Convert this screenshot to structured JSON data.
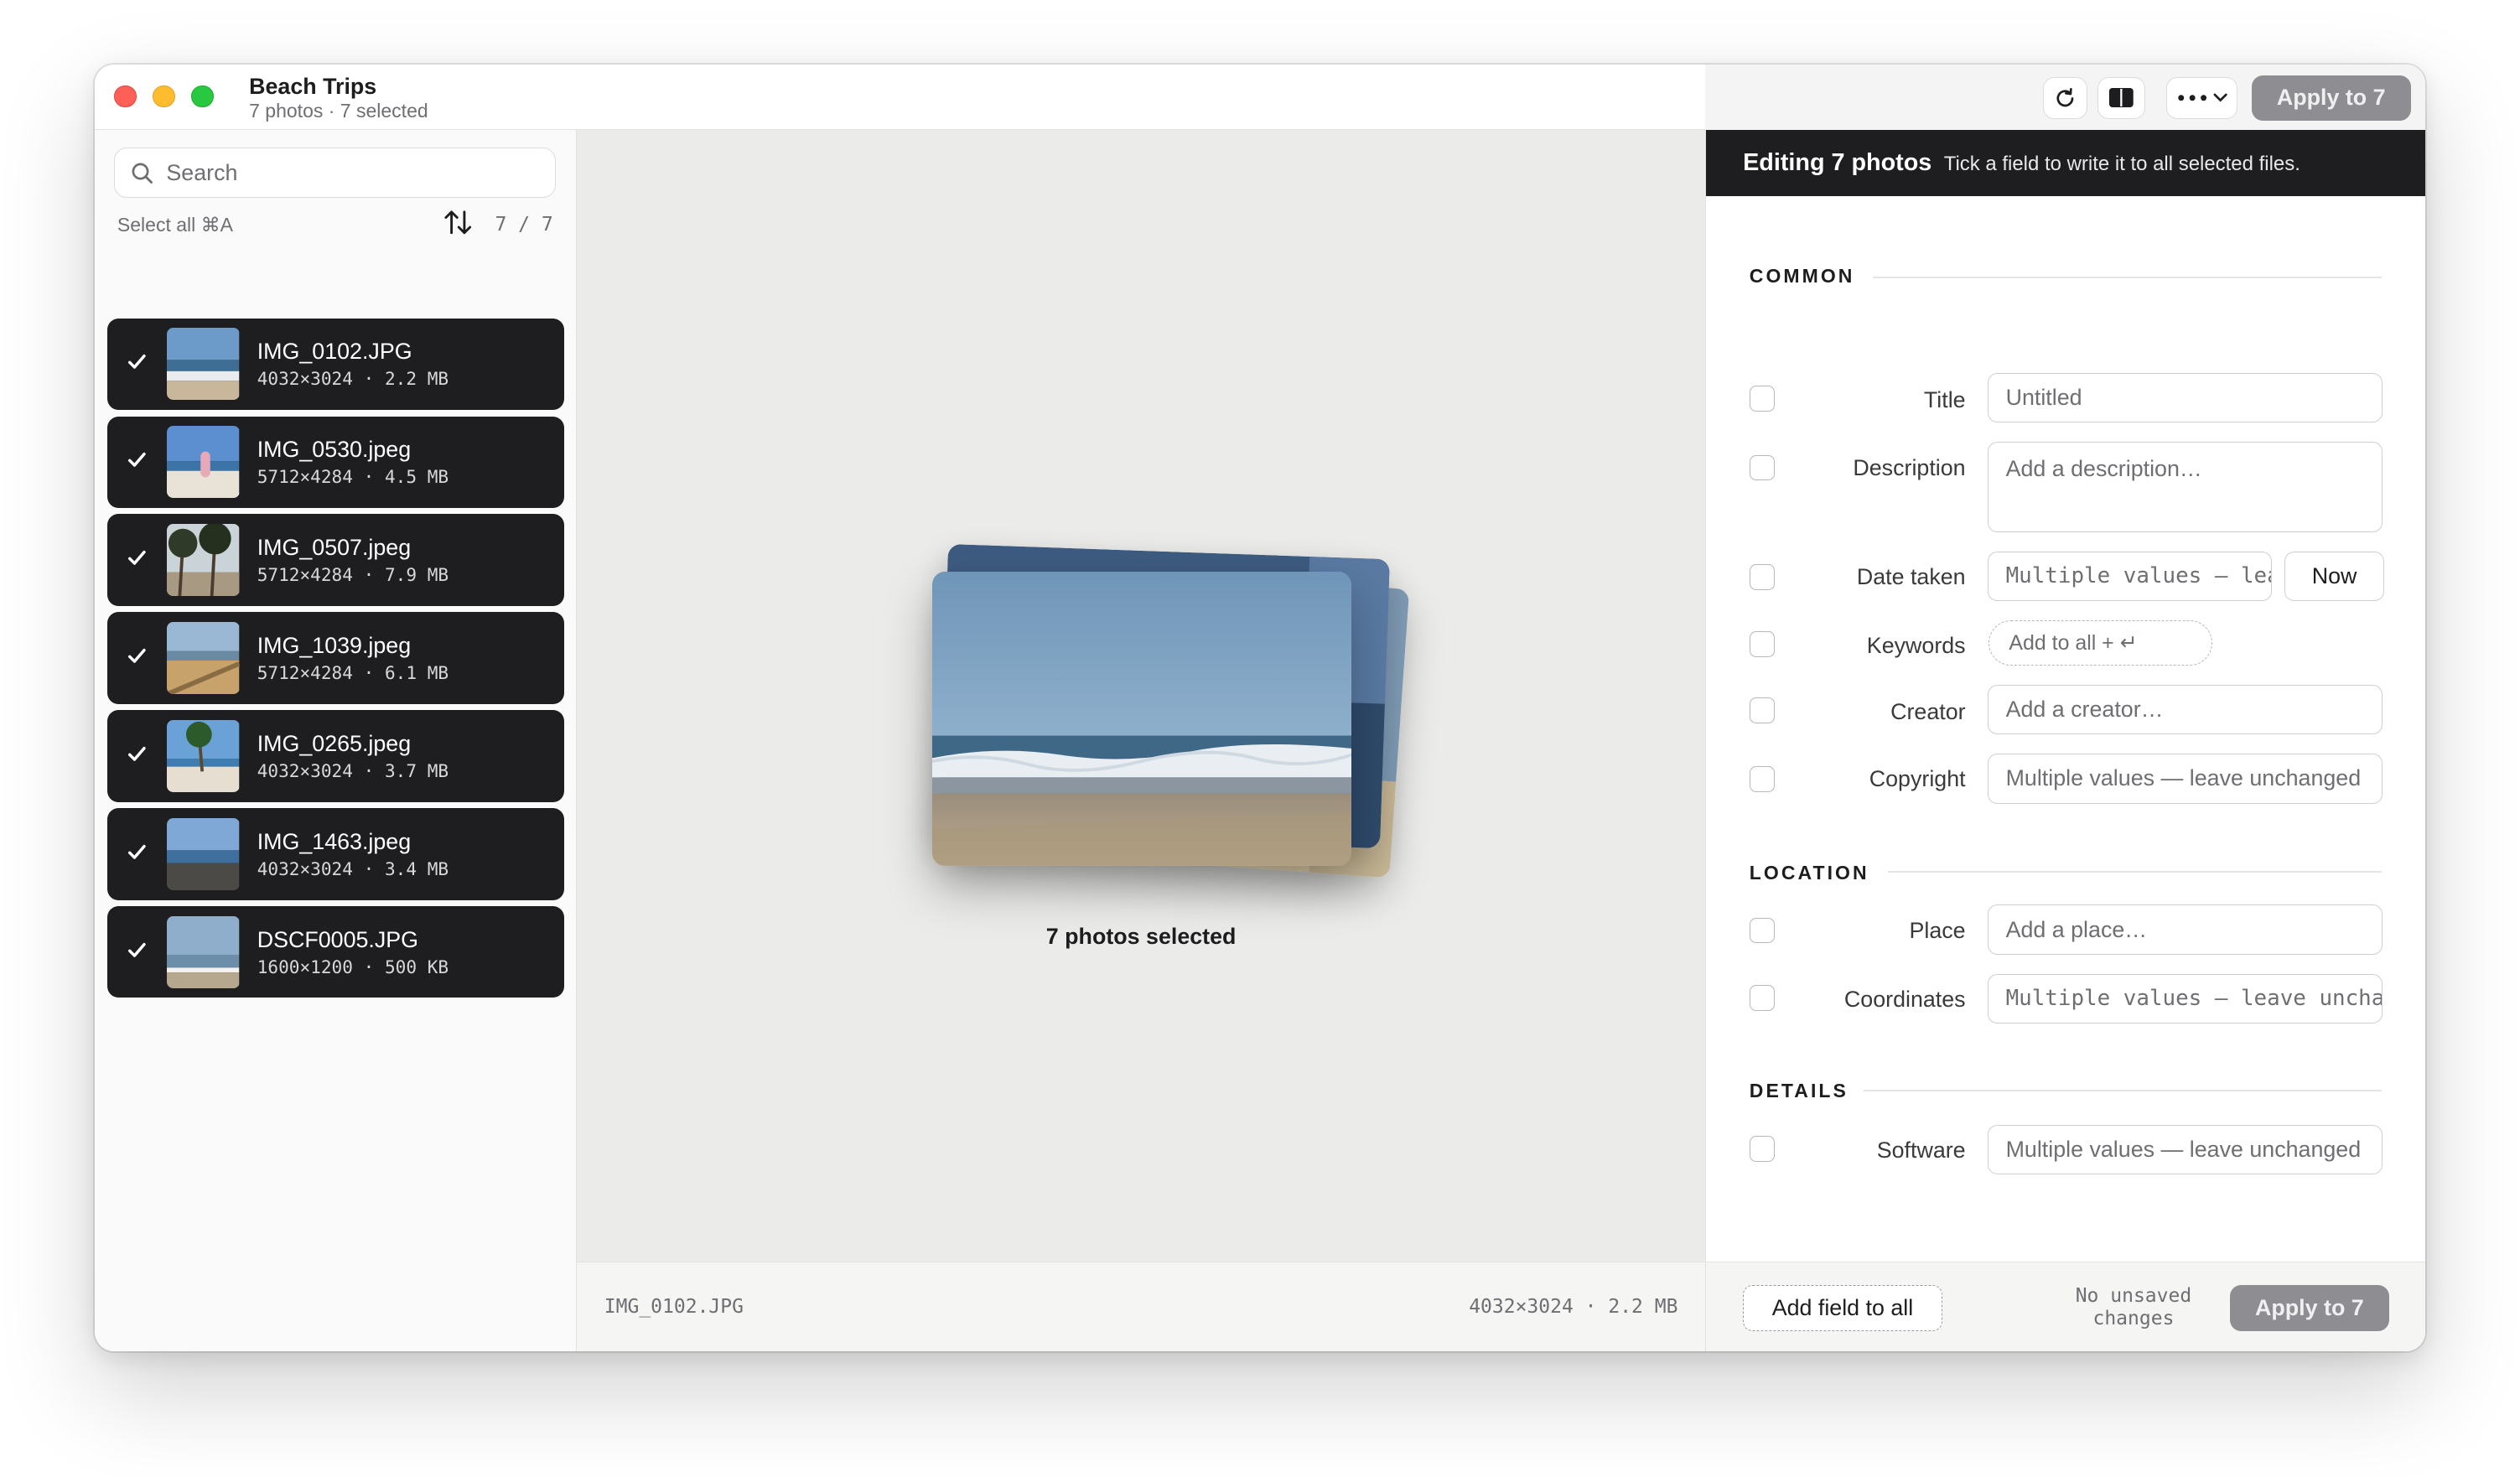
{
  "window": {
    "title": "Beach Trips",
    "subtitle": "7 photos · 7 selected"
  },
  "toolbar": {
    "refresh_icon": "refresh-icon",
    "split_icon": "split-view-icon",
    "more_icon": "more-icon",
    "apply_label": "Apply to 7"
  },
  "sidebar": {
    "search_placeholder": "Search",
    "select_all": "Select all ⌘A",
    "count": "7 / 7",
    "files": [
      {
        "name": "IMG_0102.JPG",
        "meta": "4032×3024 · 2.2 MB",
        "checked": true
      },
      {
        "name": "IMG_0530.jpeg",
        "meta": "5712×4284 · 4.5 MB",
        "checked": true
      },
      {
        "name": "IMG_0507.jpeg",
        "meta": "5712×4284 · 7.9 MB",
        "checked": true
      },
      {
        "name": "IMG_1039.jpeg",
        "meta": "5712×4284 · 6.1 MB",
        "checked": true
      },
      {
        "name": "IMG_0265.jpeg",
        "meta": "4032×3024 · 3.7 MB",
        "checked": true
      },
      {
        "name": "IMG_1463.jpeg",
        "meta": "4032×3024 · 3.4 MB",
        "checked": true
      },
      {
        "name": "DSCF0005.JPG",
        "meta": "1600×1200 · 500 KB",
        "checked": true
      }
    ]
  },
  "preview": {
    "caption": "7 photos selected",
    "status_left": "IMG_0102.JPG",
    "status_right": "4032×3024 · 2.2 MB"
  },
  "editor": {
    "banner_title": "Editing 7 photos",
    "banner_subtitle": "Tick a field to write it to all selected files.",
    "sections": {
      "common": "COMMON",
      "location": "LOCATION",
      "details": "DETAILS"
    },
    "fields": {
      "title": {
        "label": "Title",
        "placeholder": "Untitled"
      },
      "description": {
        "label": "Description",
        "placeholder": "Add a description…"
      },
      "date_taken": {
        "label": "Date taken",
        "value": "Multiple values — leave unchanged",
        "now_label": "Now"
      },
      "keywords": {
        "label": "Keywords",
        "placeholder": "Add to all + ↵"
      },
      "creator": {
        "label": "Creator",
        "placeholder": "Add a creator…"
      },
      "copyright": {
        "label": "Copyright",
        "value": "Multiple values — leave unchanged"
      },
      "place": {
        "label": "Place",
        "placeholder": "Add a place…"
      },
      "coordinates": {
        "label": "Coordinates",
        "value": "Multiple values — leave unchanged"
      },
      "software": {
        "label": "Software",
        "value": "Multiple values — leave unchanged"
      }
    },
    "footer": {
      "add_field": "Add field to all",
      "unsaved": "No unsaved changes",
      "apply": "Apply to 7"
    }
  },
  "colors": {
    "dark": "#1e1e20",
    "apply_disabled": "#8e8e92",
    "close": "#fe5f57",
    "minimize": "#febc2e",
    "zoom": "#28c840"
  }
}
